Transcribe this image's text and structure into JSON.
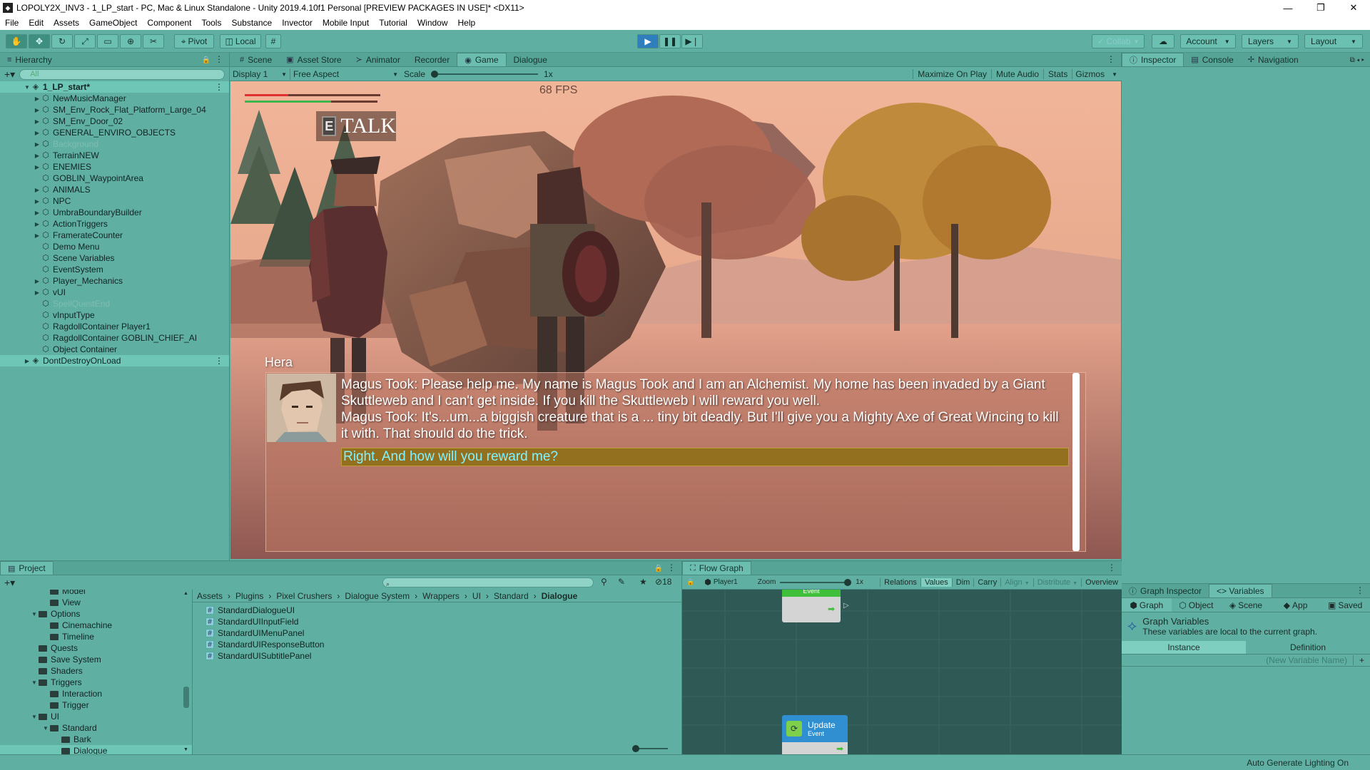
{
  "window": {
    "title": "LOPOLY2X_INV3 - 1_LP_start - PC, Mac & Linux Standalone - Unity 2019.4.10f1 Personal [PREVIEW PACKAGES IN USE]* <DX11>",
    "minimize": "—",
    "maximize": "❐",
    "close": "✕"
  },
  "menu": [
    "File",
    "Edit",
    "Assets",
    "GameObject",
    "Component",
    "Tools",
    "Substance",
    "Invector",
    "Mobile Input",
    "Tutorial",
    "Window",
    "Help"
  ],
  "toolbar": {
    "pivot": "Pivot",
    "local": "Local",
    "collab": "Collab",
    "account": "Account",
    "layers": "Layers",
    "layout": "Layout"
  },
  "hierarchy": {
    "tab": "Hierarchy",
    "search_placeholder": "All",
    "scene": "1_LP_start*",
    "items": [
      {
        "label": "NewMusicManager",
        "expand": true,
        "dim": false
      },
      {
        "label": "SM_Env_Rock_Flat_Platform_Large_04",
        "expand": true,
        "dim": false
      },
      {
        "label": "SM_Env_Door_02",
        "expand": true,
        "dim": false
      },
      {
        "label": "GENERAL_ENVIRO_OBJECTS",
        "expand": true,
        "dim": false
      },
      {
        "label": "Background",
        "expand": true,
        "dim": true
      },
      {
        "label": "TerrainNEW",
        "expand": true,
        "dim": false
      },
      {
        "label": "ENEMIES",
        "expand": true,
        "dim": false
      },
      {
        "label": "GOBLIN_WaypointArea",
        "expand": false,
        "dim": false
      },
      {
        "label": "ANIMALS",
        "expand": true,
        "dim": false
      },
      {
        "label": "NPC",
        "expand": true,
        "dim": false
      },
      {
        "label": "UmbraBoundaryBuilder",
        "expand": true,
        "dim": false
      },
      {
        "label": "ActionTriggers",
        "expand": true,
        "dim": false
      },
      {
        "label": "FramerateCounter",
        "expand": true,
        "dim": false
      },
      {
        "label": "Demo Menu",
        "expand": false,
        "dim": false
      },
      {
        "label": "Scene Variables",
        "expand": false,
        "dim": false
      },
      {
        "label": "EventSystem",
        "expand": false,
        "dim": false
      },
      {
        "label": "Player_Mechanics",
        "expand": true,
        "dim": false
      },
      {
        "label": "vUI",
        "expand": true,
        "dim": false
      },
      {
        "label": "SpellQuestEnd",
        "expand": false,
        "dim": true
      },
      {
        "label": "vInputType",
        "expand": false,
        "dim": false
      },
      {
        "label": "RagdollContainer Player1",
        "expand": false,
        "dim": false
      },
      {
        "label": "RagdollContainer GOBLIN_CHIEF_AI",
        "expand": false,
        "dim": false
      },
      {
        "label": "Object Container",
        "expand": false,
        "dim": false
      }
    ],
    "dont_destroy": "DontDestroyOnLoad"
  },
  "center_tabs": [
    "Scene",
    "Asset Store",
    "Animator",
    "Recorder",
    "Game",
    "Dialogue"
  ],
  "center_tab_icons": [
    "#",
    "🛒",
    ">",
    "",
    "👁",
    ""
  ],
  "gamebar": {
    "display": "Display 1",
    "aspect": "Free Aspect",
    "scale_label": "Scale",
    "scale_value": "1x",
    "maximize": "Maximize On Play",
    "mute": "Mute Audio",
    "stats": "Stats",
    "gizmos": "Gizmos"
  },
  "game": {
    "fps": "68 FPS",
    "talk_key": "E",
    "talk_label": "TALK",
    "health_fraction": 0.32,
    "stamina_fraction": 0.65,
    "speaker": "Hera",
    "dialogue_lines": [
      "Magus Took: Please help me. My name is Magus Took and I am an Alchemist. My home has been invaded by a Giant Skuttleweb and I can't get inside. If you kill the Skuttleweb I will reward you well.",
      "Magus Took: It's...um...a biggish creature that is a ... tiny bit deadly. But I'll give you a Mighty Axe of Great Wincing to kill it with. That should do the trick."
    ],
    "response": "Right. And how will you reward me?"
  },
  "inspector_tabs": [
    "Inspector",
    "Console",
    "Navigation"
  ],
  "graph_panel": {
    "tabs": [
      "Graph Inspector",
      "<> Variables"
    ],
    "scopes": [
      "Graph",
      "Object",
      "Scene",
      "App",
      "Saved"
    ],
    "title": "Graph Variables",
    "desc": "These variables are local to the current graph.",
    "col_instance": "Instance",
    "col_definition": "Definition",
    "new_var_placeholder": "(New Variable Name)",
    "add": "+"
  },
  "project": {
    "tab": "Project",
    "count": "18",
    "tree": [
      {
        "label": "Model",
        "depth": 3,
        "arrow": ""
      },
      {
        "label": "View",
        "depth": 3,
        "arrow": ""
      },
      {
        "label": "Options",
        "depth": 2,
        "arrow": "▼"
      },
      {
        "label": "Cinemachine",
        "depth": 3,
        "arrow": ""
      },
      {
        "label": "Timeline",
        "depth": 3,
        "arrow": ""
      },
      {
        "label": "Quests",
        "depth": 2,
        "arrow": ""
      },
      {
        "label": "Save System",
        "depth": 2,
        "arrow": ""
      },
      {
        "label": "Shaders",
        "depth": 2,
        "arrow": ""
      },
      {
        "label": "Triggers",
        "depth": 2,
        "arrow": "▼"
      },
      {
        "label": "Interaction",
        "depth": 3,
        "arrow": ""
      },
      {
        "label": "Trigger",
        "depth": 3,
        "arrow": ""
      },
      {
        "label": "UI",
        "depth": 2,
        "arrow": "▼"
      },
      {
        "label": "Standard",
        "depth": 3,
        "arrow": "▼"
      },
      {
        "label": "Bark",
        "depth": 4,
        "arrow": ""
      },
      {
        "label": "Dialogue",
        "depth": 4,
        "arrow": "",
        "selected": true
      }
    ],
    "breadcrumb": [
      "Assets",
      "Plugins",
      "Pixel Crushers",
      "Dialogue System",
      "Wrappers",
      "UI",
      "Standard",
      "Dialogue"
    ],
    "files": [
      "StandardDialogueUI",
      "StandardUIInputField",
      "StandardUIMenuPanel",
      "StandardUIResponseButton",
      "StandardUISubtitlePanel"
    ]
  },
  "flow_graph": {
    "tab": "Flow Graph",
    "target": "Player1",
    "zoom_label": "Zoom",
    "zoom_value": "1x",
    "buttons": [
      "Relations",
      "Values",
      "Dim",
      "Carry",
      "Align",
      "Distribute",
      "Overview"
    ],
    "node_top_label": "Event",
    "node_update_title": "Update",
    "node_update_sub": "Event"
  },
  "status": "Auto Generate Lighting On"
}
